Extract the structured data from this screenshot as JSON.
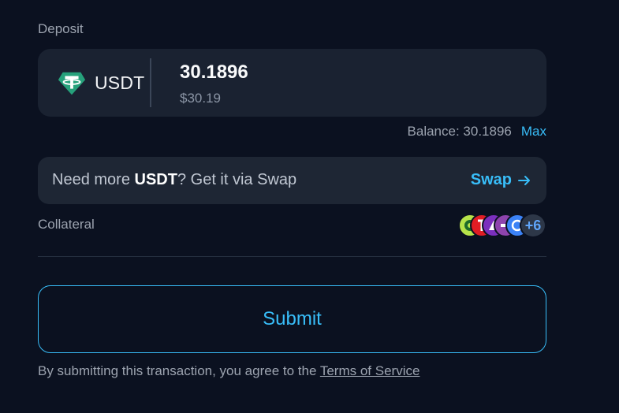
{
  "deposit": {
    "label": "Deposit",
    "token_name": "USDT",
    "token_icon": "tether-icon",
    "token_color": "#26a17b",
    "amount": "30.1896",
    "amount_usd": "$30.19"
  },
  "balance": {
    "text": "Balance: 30.1896",
    "max_label": "Max"
  },
  "swap_banner": {
    "prefix": "Need more ",
    "token": "USDT",
    "suffix": "? Get it via Swap",
    "link_label": "Swap",
    "link_icon": "arrow-right-icon"
  },
  "collateral": {
    "label": "Collateral",
    "more_count": "+6",
    "coin_colors": [
      "#b6e34a",
      "#e11d24",
      "#7b2fbe",
      "#8e44ad",
      "#3b82f6"
    ]
  },
  "submit_label": "Submit",
  "terms": {
    "prefix": "By submitting this transaction, you agree to the ",
    "link": "Terms of Service"
  },
  "colors": {
    "accent": "#38bdf8",
    "background": "#0b1120",
    "card": "#1a2231"
  }
}
